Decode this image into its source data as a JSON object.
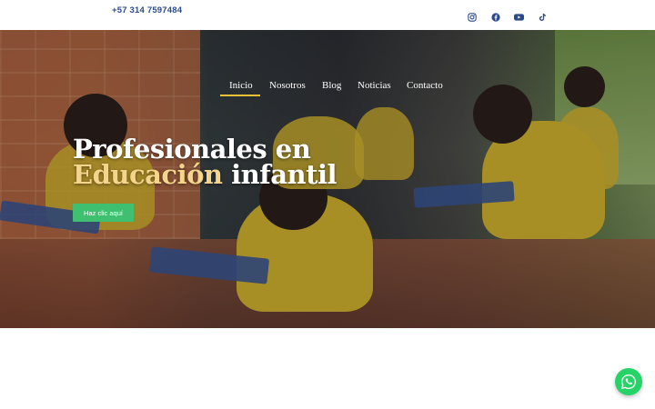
{
  "header": {
    "phone": "+57 314 7597484",
    "social_icons": [
      "instagram-icon",
      "facebook-icon",
      "youtube-icon",
      "tiktok-icon"
    ],
    "icon_color": "#2b4a8b"
  },
  "nav": {
    "items": [
      {
        "label": "Inicio",
        "active": true
      },
      {
        "label": "Nosotros"
      },
      {
        "label": "Blog"
      },
      {
        "label": "Noticias"
      },
      {
        "label": "Contacto"
      }
    ],
    "active_color": "#f0c233"
  },
  "hero": {
    "title_line1": "Profesionales en",
    "title_line2_a": "Educación",
    "title_line2_b": "infantil",
    "cta_label": "Haz clic aquí",
    "cta_color": "#3fbf70"
  },
  "floating": {
    "whatsapp_icon": "whatsapp-icon",
    "color": "#25d366"
  }
}
